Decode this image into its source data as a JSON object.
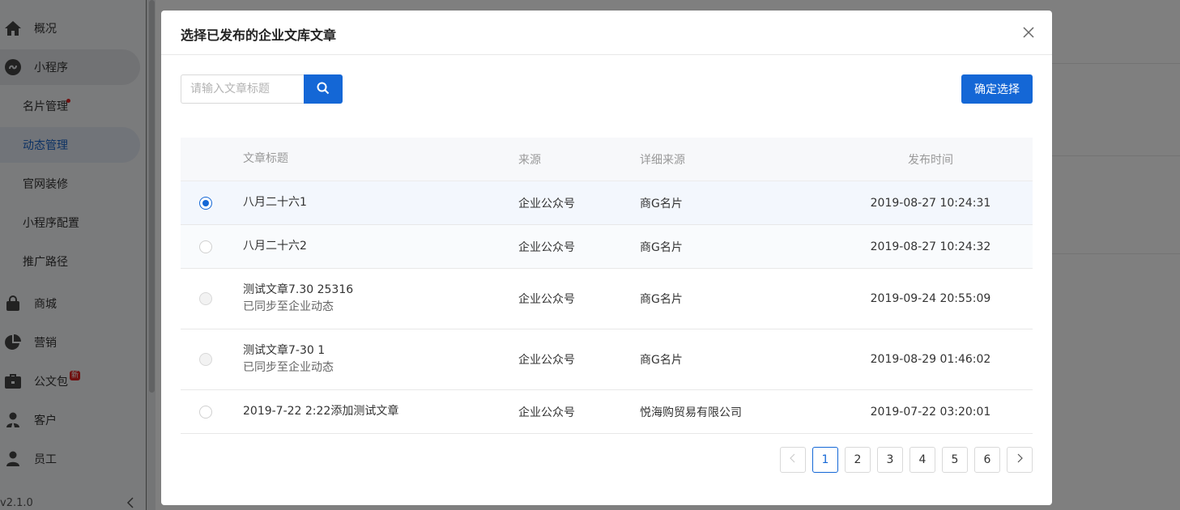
{
  "sidebar": {
    "items": [
      {
        "label": "概况",
        "icon": "home-icon"
      },
      {
        "label": "小程序",
        "icon": "mini-program-icon"
      },
      {
        "label": "商城",
        "icon": "shopping-bag-icon"
      },
      {
        "label": "营销",
        "icon": "pie-chart-icon"
      },
      {
        "label": "公文包",
        "icon": "briefcase-icon",
        "badge": "新"
      },
      {
        "label": "客户",
        "icon": "customer-icon"
      },
      {
        "label": "员工",
        "icon": "employee-icon"
      }
    ],
    "sub_items": [
      {
        "label": "名片管理",
        "has_dot": true
      },
      {
        "label": "动态管理",
        "active": true
      },
      {
        "label": "官网装修"
      },
      {
        "label": "小程序配置"
      },
      {
        "label": "推广路径"
      }
    ],
    "version": "v2.1.0"
  },
  "modal": {
    "title": "选择已发布的企业文库文章",
    "search_placeholder": "请输入文章标题",
    "confirm_label": "确定选择"
  },
  "table": {
    "headers": {
      "title": "文章标题",
      "source": "来源",
      "detail": "详细来源",
      "time": "发布时间"
    },
    "rows": [
      {
        "title": "八月二十六1",
        "sub": "",
        "source": "企业公众号",
        "detail": "商G名片",
        "time": "2019-08-27 10:24:31",
        "state": "checked"
      },
      {
        "title": "八月二十六2",
        "sub": "",
        "source": "企业公众号",
        "detail": "商G名片",
        "time": "2019-08-27 10:24:32",
        "state": "unchecked"
      },
      {
        "title": "测试文章7.30 25316",
        "sub": "已同步至企业动态",
        "source": "企业公众号",
        "detail": "商G名片",
        "time": "2019-09-24 20:55:09",
        "state": "disabled"
      },
      {
        "title": "测试文章7-30 1",
        "sub": "已同步至企业动态",
        "source": "企业公众号",
        "detail": "商G名片",
        "time": "2019-08-29 01:46:02",
        "state": "disabled"
      },
      {
        "title": "2019-7-22 2:22添加测试文章",
        "sub": "",
        "source": "企业公众号",
        "detail": "悦海购贸易有限公司",
        "time": "2019-07-22 03:20:01",
        "state": "unchecked"
      }
    ]
  },
  "pagination": {
    "prev": "<",
    "next": ">",
    "pages": [
      "1",
      "2",
      "3",
      "4",
      "5",
      "6"
    ],
    "current": "1"
  },
  "colors": {
    "primary": "#1467d6",
    "badge": "#e02020"
  }
}
